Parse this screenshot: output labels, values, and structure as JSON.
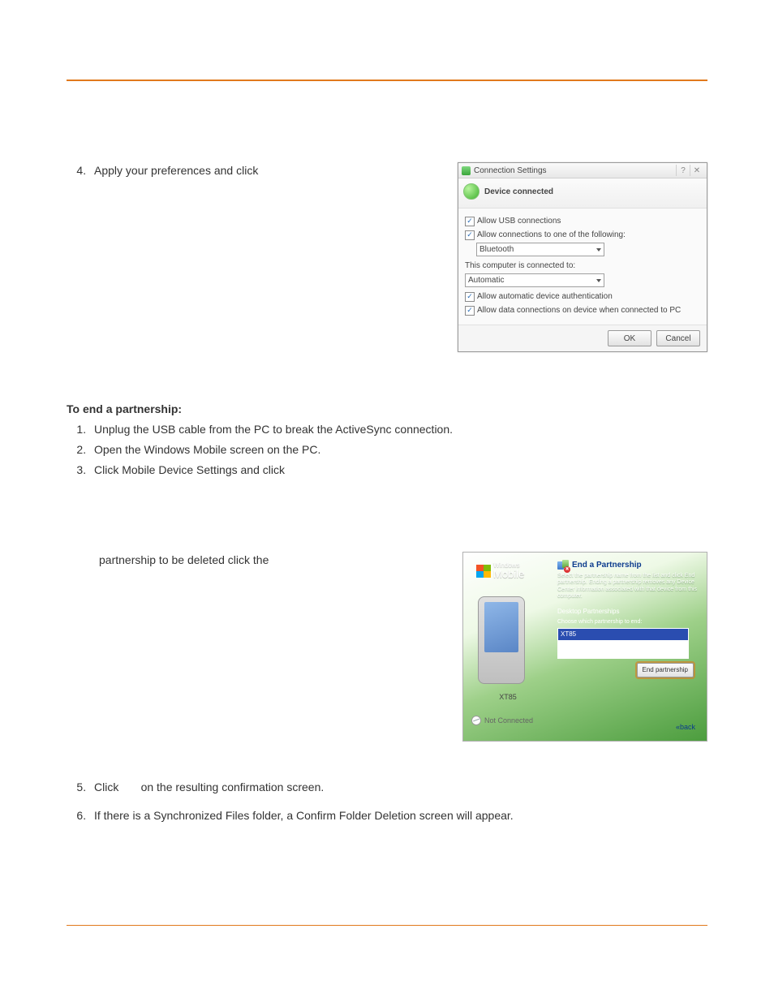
{
  "step4": "Apply your preferences and click",
  "dlg1": {
    "title": "Connection Settings",
    "help_glyph": "?",
    "close_glyph": "✕",
    "status": "Device connected",
    "chk_usb": "Allow USB connections",
    "chk_allow_one": "Allow connections to one of the following:",
    "sel1": "Bluetooth",
    "static_connected_to": "This computer is connected to:",
    "sel2": "Automatic",
    "chk_auth": "Allow automatic device authentication",
    "chk_data": "Allow data connections on device when connected to PC",
    "ok": "OK",
    "cancel": "Cancel"
  },
  "end_heading": "To end a partnership:",
  "end_steps": {
    "s1": "Unplug the USB cable from the PC to break the ActiveSync connection.",
    "s2": "Open the Windows Mobile screen on the PC.",
    "s3": "Click Mobile Device Settings and click"
  },
  "row2_text": "partnership to be deleted click the",
  "wm": {
    "brand_small": "Windows",
    "brand_big": "Mobile",
    "device_name": "XT85",
    "status": "Not Connected",
    "panel_title": "End a Partnership",
    "panel_desc": "Select the partnership name from the list and click End partnership. Ending a partnership removes any Device Center information associated with that device from this computer.",
    "section": "Desktop Partnerships",
    "choose": "Choose which partnership to end:",
    "list_item": "XT85",
    "end_btn": "End partnership",
    "back": "«back"
  },
  "step5_a": "Click",
  "step5_b": "on the resulting confirmation screen.",
  "step6": "If there is a Synchronized Files folder, a Confirm Folder Deletion screen will appear."
}
